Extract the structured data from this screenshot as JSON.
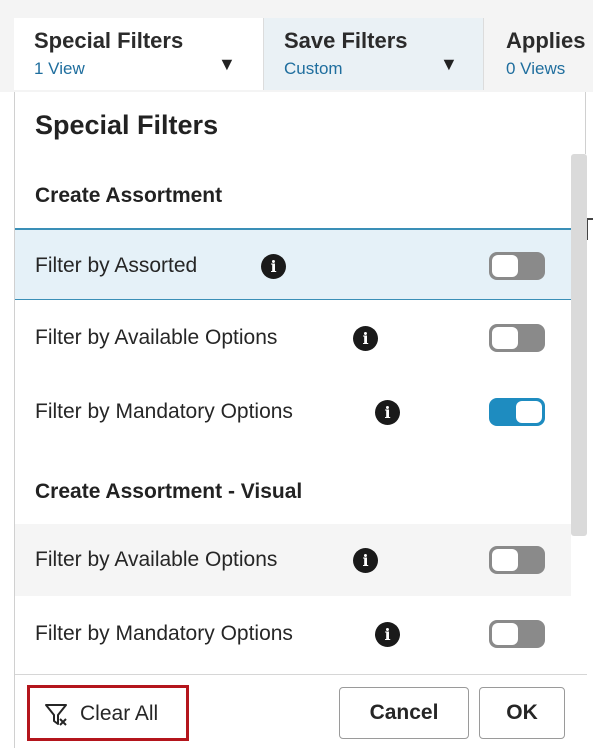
{
  "tabs": [
    {
      "title": "Special Filters",
      "subtitle": "1 View"
    },
    {
      "title": "Save Filters",
      "subtitle": "Custom"
    },
    {
      "title": "Applies",
      "subtitle": "0 Views"
    }
  ],
  "panel": {
    "title": "Special Filters",
    "sections": [
      {
        "heading": "Create Assortment",
        "rows": [
          {
            "label": "Filter by Assorted",
            "toggle_on": false,
            "selected": true
          },
          {
            "label": "Filter by Available Options",
            "toggle_on": false,
            "selected": false
          },
          {
            "label": "Filter by Mandatory Options",
            "toggle_on": true,
            "selected": false
          }
        ]
      },
      {
        "heading": "Create Assortment - Visual",
        "rows": [
          {
            "label": "Filter by Available Options",
            "toggle_on": false,
            "selected": false
          },
          {
            "label": "Filter by Mandatory Options",
            "toggle_on": false,
            "selected": false
          }
        ]
      }
    ],
    "info_glyph": "i"
  },
  "footer": {
    "clear_all_label": "Clear All",
    "clear_all_icon": "filter-clear-icon",
    "cancel_label": "Cancel",
    "ok_label": "OK"
  },
  "colors": {
    "accent": "#1e8cc0",
    "link": "#1f6e9e",
    "highlight_border": "#b4151c",
    "selected_row_bg": "#e5f1f8"
  }
}
